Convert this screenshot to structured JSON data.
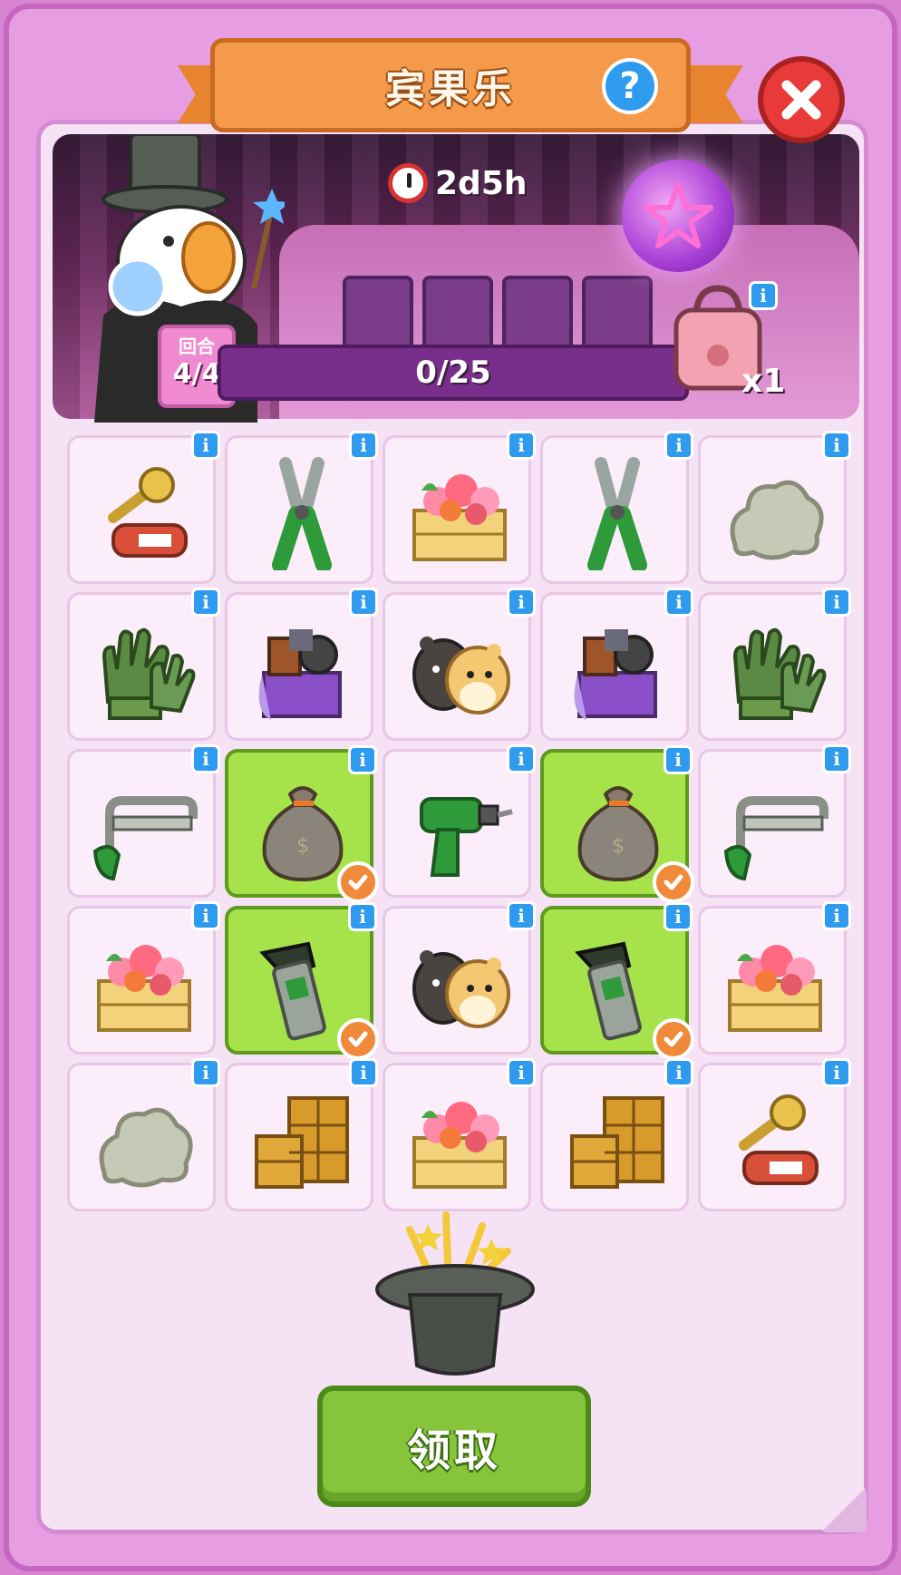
{
  "header": {
    "title": "宾果乐",
    "help_icon": "question-icon",
    "close_icon": "close-icon"
  },
  "banner": {
    "timer": "2d5h",
    "round_label": "回合",
    "round_value": "4/4",
    "progress_text": "0/25",
    "progress_fraction": 0,
    "bag_count": "x1"
  },
  "grid": {
    "items": [
      {
        "icon": "key-tag-icon",
        "done": false
      },
      {
        "icon": "pliers-icon",
        "done": false
      },
      {
        "icon": "flower-crate-icon",
        "done": false
      },
      {
        "icon": "pliers-icon",
        "done": false
      },
      {
        "icon": "rock-pile-icon",
        "done": false
      },
      {
        "icon": "work-gloves-icon",
        "done": false
      },
      {
        "icon": "junk-box-icon",
        "done": false
      },
      {
        "icon": "hamsters-icon",
        "done": false
      },
      {
        "icon": "junk-box-icon",
        "done": false
      },
      {
        "icon": "work-gloves-icon",
        "done": false
      },
      {
        "icon": "hacksaw-icon",
        "done": false
      },
      {
        "icon": "money-sack-icon",
        "done": true
      },
      {
        "icon": "power-drill-icon",
        "done": false
      },
      {
        "icon": "money-sack-icon",
        "done": true
      },
      {
        "icon": "hacksaw-icon",
        "done": false
      },
      {
        "icon": "flower-crate-icon",
        "done": false
      },
      {
        "icon": "pipe-wrench-icon",
        "done": true
      },
      {
        "icon": "hamsters-icon",
        "done": false
      },
      {
        "icon": "pipe-wrench-icon",
        "done": true
      },
      {
        "icon": "flower-crate-icon",
        "done": false
      },
      {
        "icon": "rock-pile-icon",
        "done": false
      },
      {
        "icon": "drawer-cabinets-icon",
        "done": false
      },
      {
        "icon": "flower-crate-icon",
        "done": false
      },
      {
        "icon": "drawer-cabinets-icon",
        "done": false
      },
      {
        "icon": "key-tag-icon",
        "done": false
      }
    ]
  },
  "footer": {
    "claim_label": "领取",
    "hat_icon": "magic-hat-icon"
  },
  "colors": {
    "accent_orange": "#f59a4a",
    "claim_green": "#86c53b",
    "done_green": "#a6e24a",
    "info_blue": "#2f9bee",
    "close_red": "#e83a38"
  }
}
